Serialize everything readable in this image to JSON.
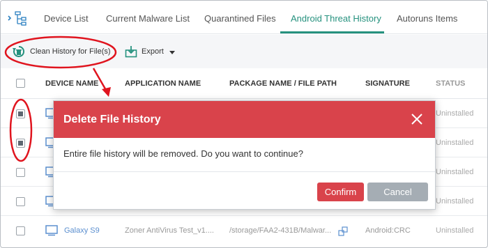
{
  "tabs": [
    {
      "label": "Device List",
      "active": false
    },
    {
      "label": "Current Malware List",
      "active": false
    },
    {
      "label": "Quarantined Files",
      "active": false
    },
    {
      "label": "Android Threat History",
      "active": true
    },
    {
      "label": "Autoruns Items",
      "active": false
    }
  ],
  "toolbar": {
    "clean_label": "Clean History for File(s)",
    "export_label": "Export"
  },
  "table": {
    "columns": [
      "DEVICE NAME",
      "APPLICATION NAME",
      "PACKAGE NAME / FILE PATH",
      "SIGNATURE",
      "STATUS"
    ],
    "rows": [
      {
        "checked": true,
        "status": "Uninstalled"
      },
      {
        "checked": true,
        "status": "Uninstalled"
      },
      {
        "checked": false,
        "status": "Uninstalled"
      },
      {
        "checked": false,
        "status": "Uninstalled"
      },
      {
        "checked": false,
        "device": "Galaxy S9",
        "application": "Zoner AntiVirus Test_v1....",
        "path": "/storage/FAA2-431B/Malwar...",
        "signature": "Android:CRC",
        "status": "Uninstalled"
      }
    ]
  },
  "dialog": {
    "title": "Delete File History",
    "message": "Entire file history will be removed. Do you want to continue?",
    "confirm_label": "Confirm",
    "cancel_label": "Cancel"
  },
  "colors": {
    "accent": "#25917e",
    "danger": "#d9434b",
    "link": "#5b8fcf",
    "annotation": "#e0141e"
  }
}
